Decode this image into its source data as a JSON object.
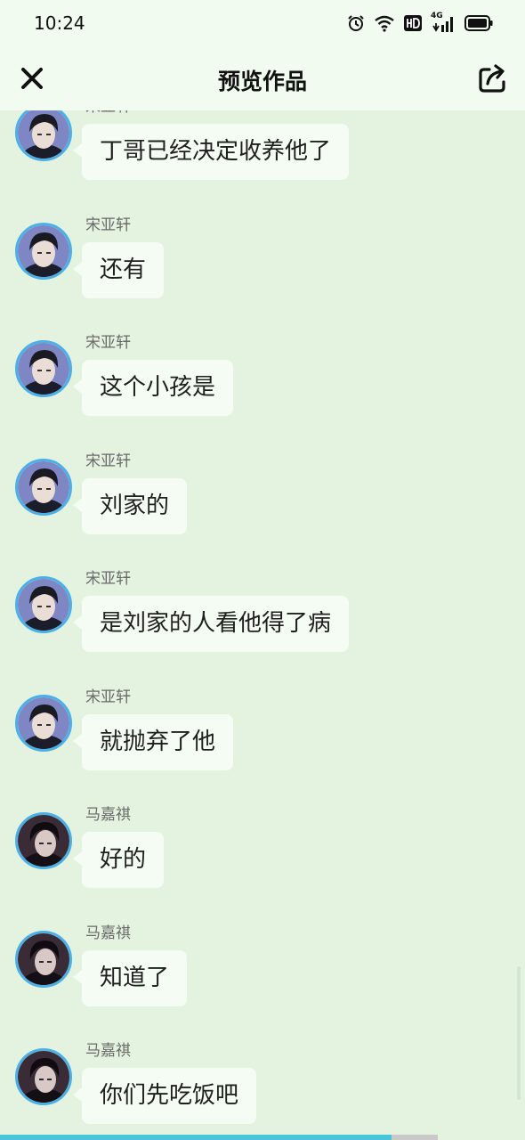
{
  "status_bar": {
    "time": "10:24",
    "network_label": "4G"
  },
  "header": {
    "title": "预览作品"
  },
  "messages": [
    {
      "name": "宋亚轩",
      "text": "丁哥已经决定收养他了",
      "avatar_icon": "song-avatar"
    },
    {
      "name": "宋亚轩",
      "text": "还有",
      "avatar_icon": "song-avatar"
    },
    {
      "name": "宋亚轩",
      "text": "这个小孩是",
      "avatar_icon": "song-avatar"
    },
    {
      "name": "宋亚轩",
      "text": "刘家的",
      "avatar_icon": "song-avatar"
    },
    {
      "name": "宋亚轩",
      "text": "是刘家的人看他得了病",
      "avatar_icon": "song-avatar"
    },
    {
      "name": "宋亚轩",
      "text": "就抛弃了他",
      "avatar_icon": "song-avatar"
    },
    {
      "name": "马嘉祺",
      "text": "好的",
      "avatar_icon": "ma-avatar"
    },
    {
      "name": "马嘉祺",
      "text": "知道了",
      "avatar_icon": "ma-avatar"
    },
    {
      "name": "马嘉祺",
      "text": "你们先吃饭吧",
      "avatar_icon": "ma-avatar"
    }
  ],
  "colors": {
    "background": "#e3f3df",
    "bubble": "#f5fcf3",
    "avatar_ring": "#4ab0e8",
    "progress": "#49c6d9"
  }
}
